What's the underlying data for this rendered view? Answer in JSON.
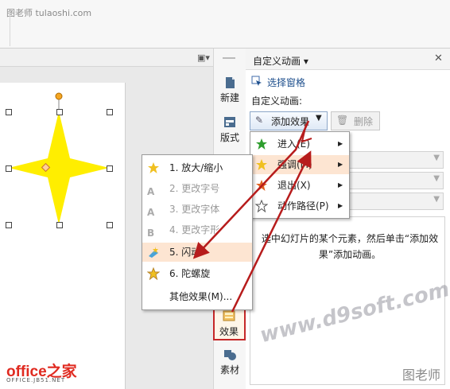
{
  "watermark_top": "图老师 tulaoshi.com",
  "taskbar": {
    "new_label": "新建",
    "layout_label": "版式",
    "effect_label": "效果",
    "material_label": "素材"
  },
  "pane": {
    "title": "自定义动画",
    "title_dropdown": "▾",
    "close": "✕",
    "select_pane": "选择窗格",
    "custom_anim_label": "自定义动画:",
    "add_effect": "添加效果",
    "delete": "删除",
    "hint": "选中幻灯片的某个元素，然后单击“添加效果”添加动画。"
  },
  "add_menu": {
    "items": [
      {
        "label": "进入(E)",
        "icon": "green-star-icon"
      },
      {
        "label": "强调(M)",
        "icon": "yellow-star-icon"
      },
      {
        "label": "退出(X)",
        "icon": "red-star-icon"
      },
      {
        "label": "动作路径(P)",
        "icon": "outline-star-icon"
      }
    ]
  },
  "emphasis_menu": {
    "items": [
      {
        "label": "1. 放大/缩小",
        "enabled": true
      },
      {
        "label": "2. 更改字号",
        "enabled": false
      },
      {
        "label": "3. 更改字体",
        "enabled": false
      },
      {
        "label": "4. 更改字形",
        "enabled": false
      },
      {
        "label": "5. 闪动",
        "enabled": true
      },
      {
        "label": "6. 陀螺旋",
        "enabled": true
      },
      {
        "label": "其他效果(M)...",
        "enabled": true
      }
    ]
  },
  "logos": {
    "office": "office之家",
    "office_sub": "OFFICE.JB51.NET",
    "d9soft": "www.d9soft.com",
    "tulaoshi": "图老师"
  },
  "colors": {
    "star": "#ffee00",
    "highlight_box": "#c62828",
    "arrow": "#b71c1c"
  }
}
